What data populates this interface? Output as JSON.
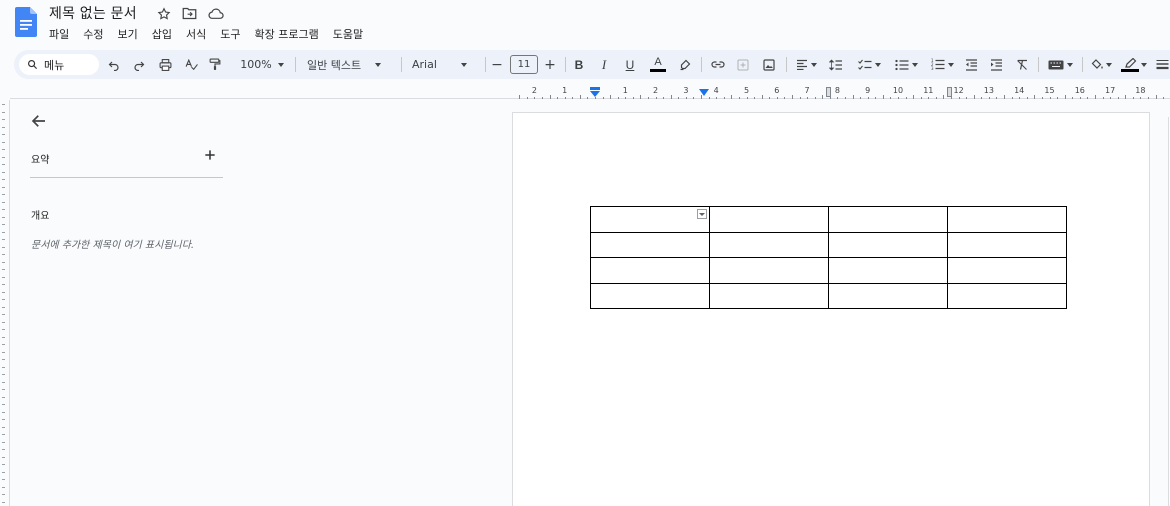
{
  "header": {
    "title": "제목 없는 문서",
    "icons": [
      "star-icon",
      "move-to-folder-icon",
      "cloud-status-icon"
    ]
  },
  "menubar": {
    "items": [
      "파일",
      "수정",
      "보기",
      "삽입",
      "서식",
      "도구",
      "확장 프로그램",
      "도움말"
    ]
  },
  "toolbar": {
    "search_label": "메뉴",
    "zoom": "100%",
    "style": "일반 텍스트",
    "font": "Arial",
    "font_size": "11",
    "minus": "−",
    "plus": "+",
    "bold": "B",
    "italic": "I",
    "underline": "U",
    "text_color_letter": "A"
  },
  "ruler": {
    "labels": [
      "2",
      "1",
      "",
      "1",
      "2",
      "3",
      "4",
      "5",
      "6",
      "7",
      "8",
      "9",
      "10",
      "11",
      "12",
      "13",
      "14",
      "15",
      "16",
      "17",
      "18"
    ]
  },
  "outline": {
    "summary_label": "요약",
    "outline_label": "개요",
    "empty_text": "문서에 추가한 제목이 여기 표시됩니다."
  },
  "document": {
    "table": {
      "rows": 4,
      "cols": 4
    }
  },
  "colors": {
    "accent": "#1a73e8",
    "toolbar_bg": "#edf2fa",
    "page_bg": "#f9fbfd"
  }
}
